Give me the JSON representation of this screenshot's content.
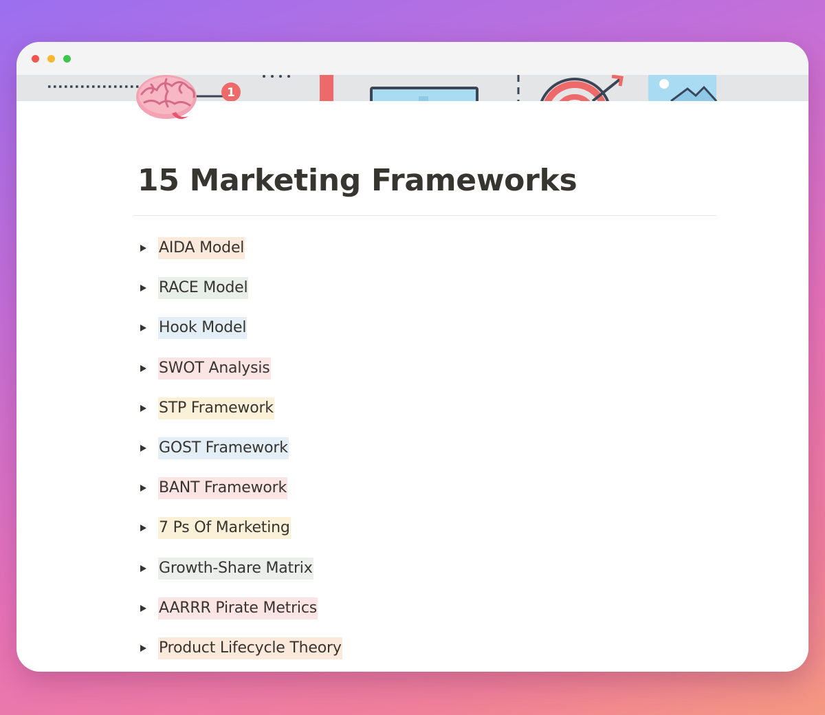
{
  "window": {
    "controls": [
      "close",
      "minimize",
      "maximize"
    ]
  },
  "cover": {
    "icons": [
      "timeline-icon",
      "brain-icon",
      "monitor-icon",
      "target-icon",
      "image-icon"
    ]
  },
  "page": {
    "icon": "brain-icon",
    "title": "15 Marketing Frameworks"
  },
  "toggles": [
    {
      "label": "AIDA Model",
      "highlight": "#fbe9dc"
    },
    {
      "label": "RACE Model",
      "highlight": "#e8efe9"
    },
    {
      "label": "Hook Model",
      "highlight": "#e4eef6"
    },
    {
      "label": "SWOT Analysis",
      "highlight": "#fbe4e4"
    },
    {
      "label": "STP Framework",
      "highlight": "#fbf1d9"
    },
    {
      "label": "GOST Framework",
      "highlight": "#e4eef6"
    },
    {
      "label": "BANT Framework",
      "highlight": "#fbe4e4"
    },
    {
      "label": "7 Ps Of Marketing",
      "highlight": "#fbf1d9"
    },
    {
      "label": "Growth-Share Matrix",
      "highlight": "#ebeeeb"
    },
    {
      "label": "AARRR Pirate Metrics",
      "highlight": "#fbe4e4"
    },
    {
      "label": "Product Lifecycle Theory",
      "highlight": "#fbe9dc"
    }
  ],
  "colors": {
    "text": "#37352f",
    "background_gradient": [
      "#9b6ff0",
      "#f49880"
    ]
  }
}
